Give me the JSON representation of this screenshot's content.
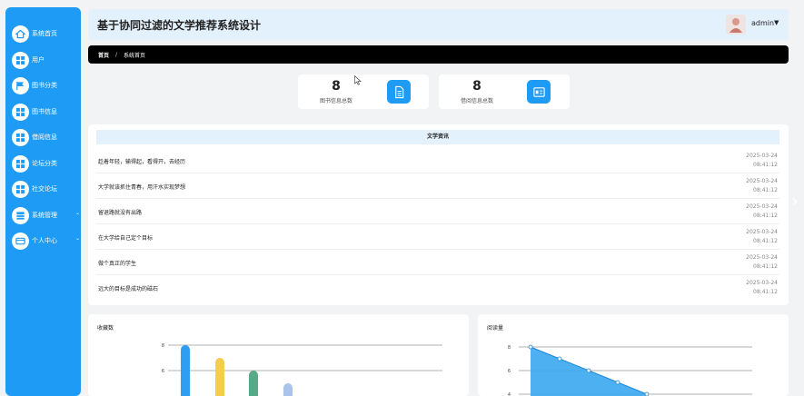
{
  "sidebar": {
    "items": [
      {
        "label": "系统首页",
        "icon": "home-icon",
        "expandable": false
      },
      {
        "label": "用户",
        "icon": "grid-icon",
        "expandable": false
      },
      {
        "label": "图书分类",
        "icon": "flag-icon",
        "expandable": false
      },
      {
        "label": "图书信息",
        "icon": "grid-icon",
        "expandable": false
      },
      {
        "label": "借阅信息",
        "icon": "grid-icon",
        "expandable": false
      },
      {
        "label": "论坛分类",
        "icon": "grid-icon",
        "expandable": false
      },
      {
        "label": "社交论坛",
        "icon": "grid-icon",
        "expandable": false
      },
      {
        "label": "系统管理",
        "icon": "server-icon",
        "expandable": true
      },
      {
        "label": "个人中心",
        "icon": "card-icon",
        "expandable": true
      }
    ]
  },
  "header": {
    "title": "基于协同过滤的文学推荐系统设计",
    "user": "admin"
  },
  "breadcrumb": {
    "home": "首页",
    "separator": "/",
    "current": "系统首页"
  },
  "stats": [
    {
      "value": "8",
      "label": "图书信息总数",
      "icon": "document-icon"
    },
    {
      "value": "8",
      "label": "借阅信息总数",
      "icon": "id-card-icon"
    }
  ],
  "news": {
    "title": "文学资讯",
    "items": [
      {
        "text": "趁着年轻，输得起，看得开，去经历",
        "date": "2025-03-24",
        "time": "08:41:12"
      },
      {
        "text": "大学就该抓住青春，用汗水实现梦想",
        "date": "2025-03-24",
        "time": "08:41:12"
      },
      {
        "text": "留退路就没有出路",
        "date": "2025-03-24",
        "time": "08:41:12"
      },
      {
        "text": "在大学给自己定个目标",
        "date": "2025-03-24",
        "time": "08:41:12"
      },
      {
        "text": "做个真正的学生",
        "date": "2025-03-24",
        "time": "08:41:12"
      },
      {
        "text": "远大的目标是成功的磁石",
        "date": "2025-03-24",
        "time": "08:41:12"
      }
    ]
  },
  "colors": {
    "accent": "#1e9bf5",
    "header_bg": "#e3f1fd",
    "breadcrumb_bg": "#000000"
  },
  "chart_data": [
    {
      "type": "bar",
      "title": "收藏数",
      "xlabel": "",
      "ylabel": "",
      "ylim": [
        0,
        8
      ],
      "yticks": [
        "8",
        "6"
      ],
      "values": [
        8,
        7,
        6,
        5
      ],
      "colors": [
        "#2d9ef2",
        "#f5cd4e",
        "#58a987",
        "#a9c3ea"
      ],
      "grid": true
    },
    {
      "type": "area",
      "title": "阅读量",
      "xlabel": "",
      "ylabel": "",
      "ylim": [
        0,
        8
      ],
      "yticks": [
        "8",
        "6",
        "4"
      ],
      "values": [
        8,
        7,
        6,
        5,
        4
      ],
      "color": "#3aa9f0",
      "grid": true
    }
  ]
}
